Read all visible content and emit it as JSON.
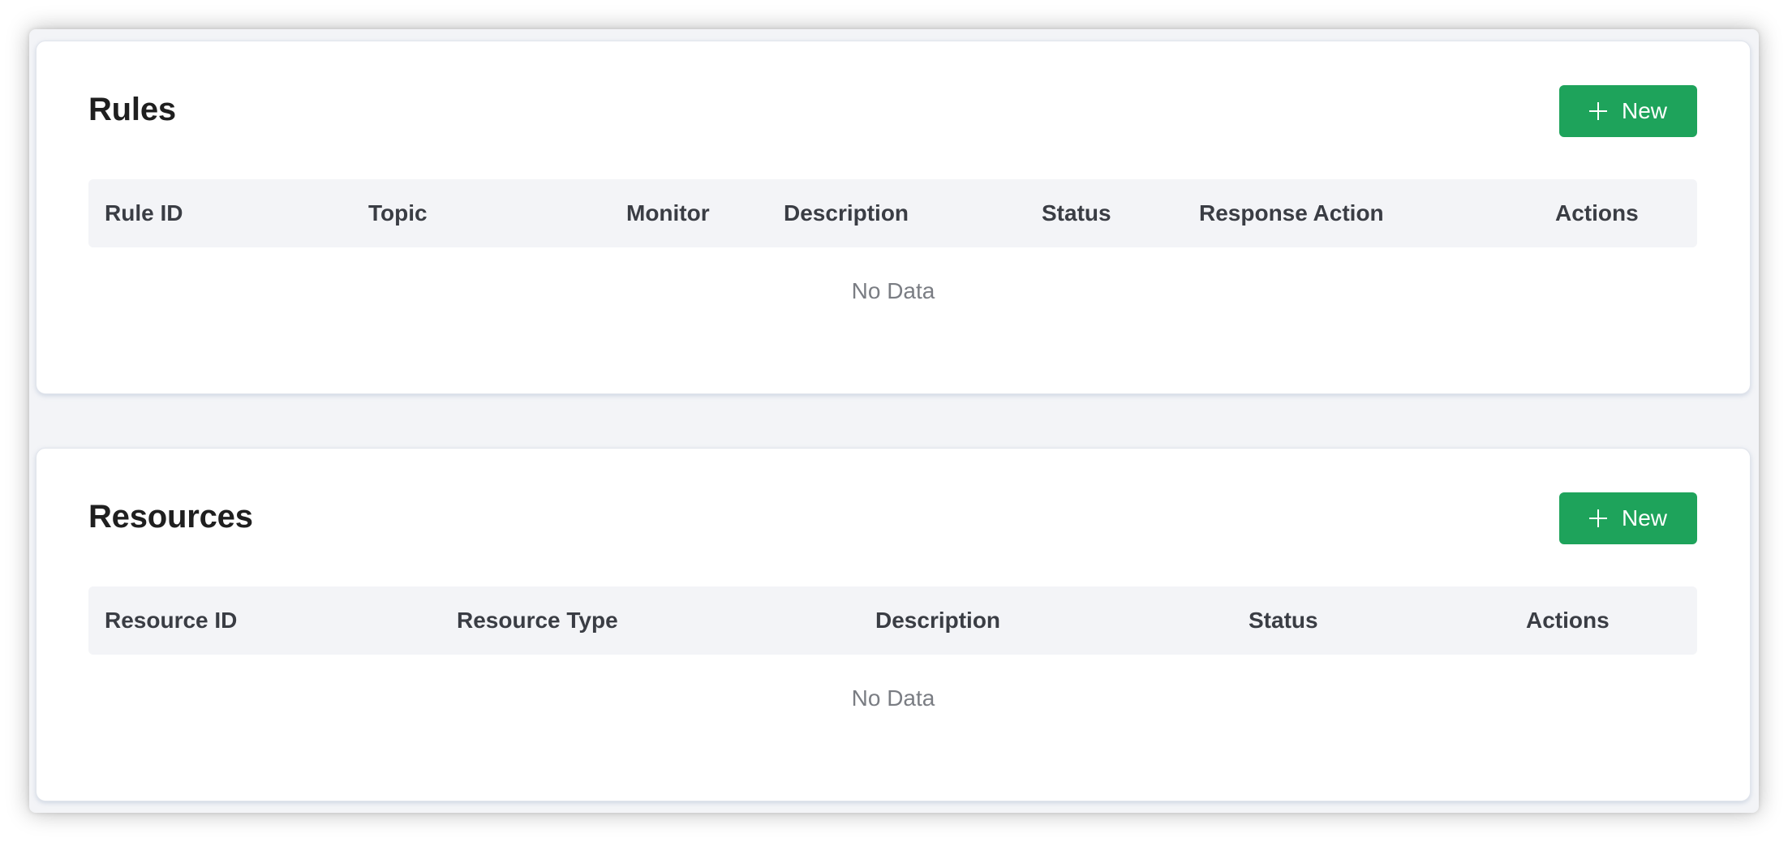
{
  "rules": {
    "title": "Rules",
    "new_label": "New",
    "columns": [
      "Rule ID",
      "Topic",
      "Monitor",
      "Description",
      "Status",
      "Response Action",
      "Actions"
    ],
    "empty_text": "No Data"
  },
  "resources": {
    "title": "Resources",
    "new_label": "New",
    "columns": [
      "Resource ID",
      "Resource Type",
      "Description",
      "Status",
      "Actions"
    ],
    "empty_text": "No Data"
  },
  "colors": {
    "primary": "#1ea35b",
    "header_bg": "#f3f4f7",
    "page_bg": "#f3f4f7"
  },
  "icons": {
    "new_button_icon": "plus-icon"
  }
}
